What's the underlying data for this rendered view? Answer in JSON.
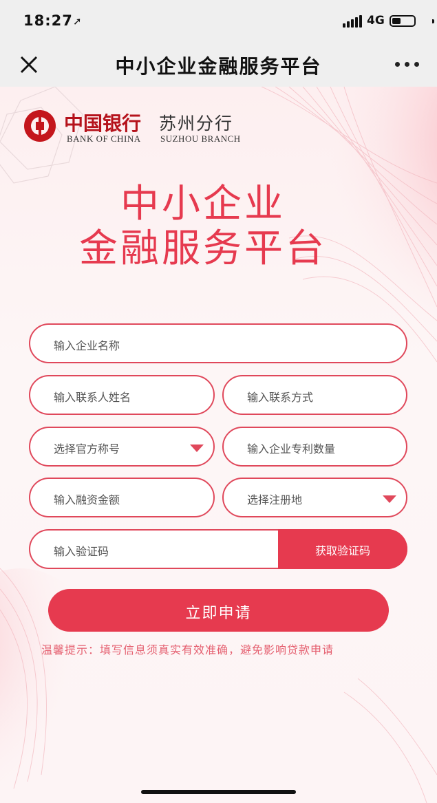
{
  "status_bar": {
    "time": "18:27",
    "network": "4G"
  },
  "nav": {
    "title": "中小企业金融服务平台"
  },
  "brand": {
    "name_cn": "中国银行",
    "branch_cn": "苏州分行",
    "name_en": "BANK OF CHINA",
    "branch_en": "SUZHOU BRANCH"
  },
  "hero": {
    "line1": "中小企业",
    "line2": "金融服务平台"
  },
  "form": {
    "company_name": "输入企业名称",
    "contact_name": "输入联系人姓名",
    "contact_phone": "输入联系方式",
    "title_select": "选择官方称号",
    "patent_count": "输入企业专利数量",
    "financing_amount": "输入融资金额",
    "region_select": "选择注册地",
    "verify_code": "输入验证码",
    "get_code": "获取验证码",
    "submit": "立即申请"
  },
  "tip": "温馨提示：填写信息须真实有效准确，避免影响贷款申请",
  "colors": {
    "accent": "#e63a4f",
    "brand_red": "#c4161c"
  }
}
